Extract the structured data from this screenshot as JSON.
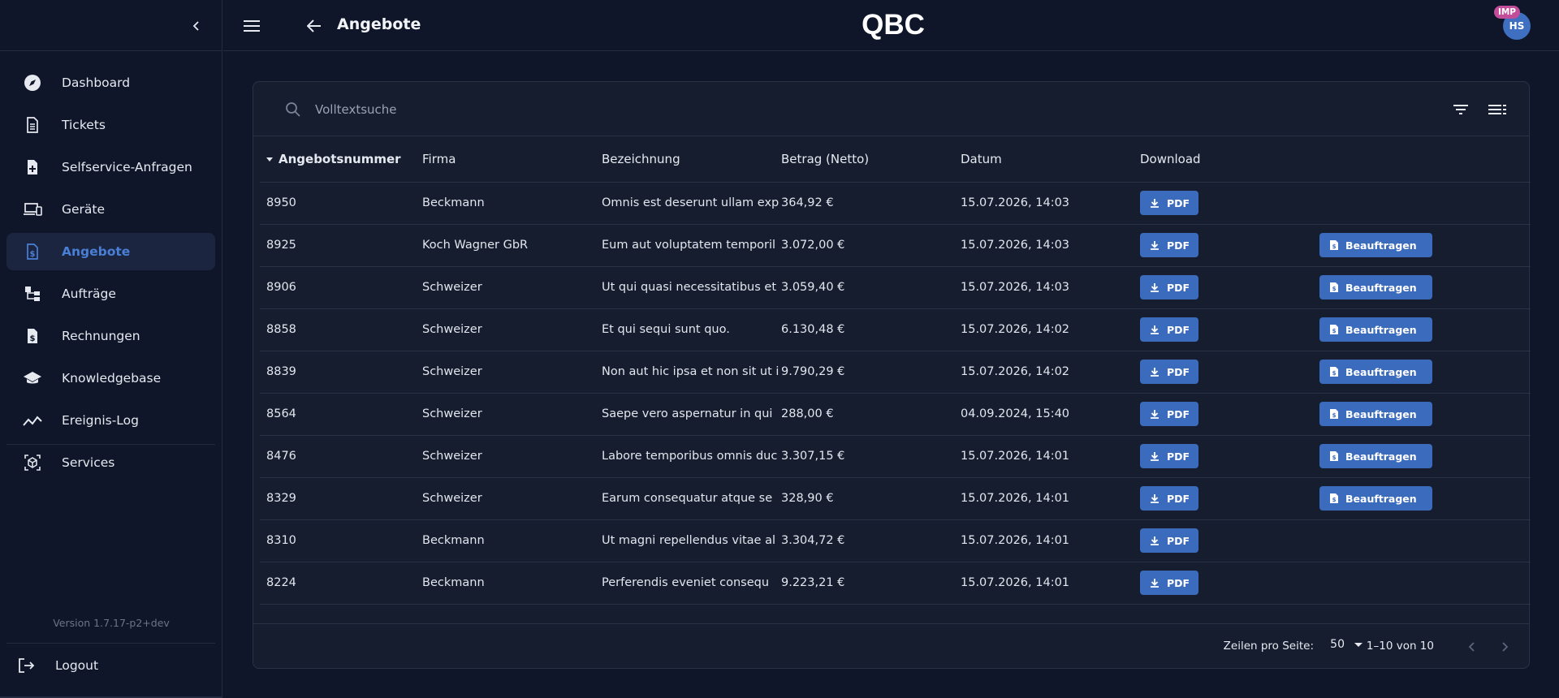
{
  "sidebar": {
    "items": [
      {
        "label": "Dashboard",
        "icon": "compass-icon"
      },
      {
        "label": "Tickets",
        "icon": "document-icon"
      },
      {
        "label": "Selfservice-Anfragen",
        "icon": "document-plus-icon"
      },
      {
        "label": "Geräte",
        "icon": "devices-icon"
      },
      {
        "label": "Angebote",
        "icon": "document-dollar-icon",
        "active": true
      },
      {
        "label": "Aufträge",
        "icon": "hierarchy-icon"
      },
      {
        "label": "Rechnungen",
        "icon": "invoice-icon"
      },
      {
        "label": "Knowledgebase",
        "icon": "graduation-cap-icon"
      },
      {
        "label": "Ereignis-Log",
        "icon": "trend-line-icon"
      }
    ],
    "services_label": "Services",
    "version": "Version 1.7.17-p2+dev",
    "logout_label": "Logout"
  },
  "topbar": {
    "title": "Angebote",
    "logo_text": "QBC",
    "avatar_initials": "HS",
    "impersonation_badge": "IMP"
  },
  "search": {
    "placeholder": "Volltextsuche",
    "value": ""
  },
  "table": {
    "headers": [
      "Angebotsnummer",
      "Firma",
      "Bezeichnung",
      "Betrag (Netto)",
      "Datum",
      "Download"
    ],
    "sorted_column": "Angebotsnummer",
    "sort_direction": "desc",
    "pdf_label": "PDF",
    "order_label": "Beauftragen",
    "rows": [
      {
        "nr": "8950",
        "firma": "Beckmann",
        "bez": "Omnis est deserunt ullam exp",
        "betrag": "364,92 €",
        "datum": "15.07.2026, 14:03",
        "order": false
      },
      {
        "nr": "8925",
        "firma": "Koch Wagner GbR",
        "bez": "Eum aut voluptatem temporil",
        "betrag": "3.072,00 €",
        "datum": "15.07.2026, 14:03",
        "order": true
      },
      {
        "nr": "8906",
        "firma": "Schweizer",
        "bez": "Ut qui quasi necessitatibus et",
        "betrag": "3.059,40 €",
        "datum": "15.07.2026, 14:03",
        "order": true
      },
      {
        "nr": "8858",
        "firma": "Schweizer",
        "bez": "Et qui sequi sunt quo.",
        "betrag": "6.130,48 €",
        "datum": "15.07.2026, 14:02",
        "order": true
      },
      {
        "nr": "8839",
        "firma": "Schweizer",
        "bez": "Non aut hic ipsa et non sit ut i",
        "betrag": "9.790,29 €",
        "datum": "15.07.2026, 14:02",
        "order": true
      },
      {
        "nr": "8564",
        "firma": "Schweizer",
        "bez": "Saepe vero aspernatur in qui",
        "betrag": "288,00 €",
        "datum": "04.09.2024, 15:40",
        "order": true
      },
      {
        "nr": "8476",
        "firma": "Schweizer",
        "bez": "Labore temporibus omnis duc",
        "betrag": "3.307,15 €",
        "datum": "15.07.2026, 14:01",
        "order": true
      },
      {
        "nr": "8329",
        "firma": "Schweizer",
        "bez": "Earum consequatur atque se",
        "betrag": "328,90 €",
        "datum": "15.07.2026, 14:01",
        "order": true
      },
      {
        "nr": "8310",
        "firma": "Beckmann",
        "bez": "Ut magni repellendus vitae al",
        "betrag": "3.304,72 €",
        "datum": "15.07.2026, 14:01",
        "order": false
      },
      {
        "nr": "8224",
        "firma": "Beckmann",
        "bez": "Perferendis eveniet consequ",
        "betrag": "9.223,21 €",
        "datum": "15.07.2026, 14:01",
        "order": false
      }
    ]
  },
  "pagination": {
    "rows_per_page_label": "Zeilen pro Seite:",
    "rows_per_page": "50",
    "range": "1–10 von 10"
  },
  "colors": {
    "background": "#0f1629",
    "card": "#161d2f",
    "accent": "#3b6bbd",
    "active_nav_text": "#4a7fd6",
    "badge": "#c14d9b"
  }
}
